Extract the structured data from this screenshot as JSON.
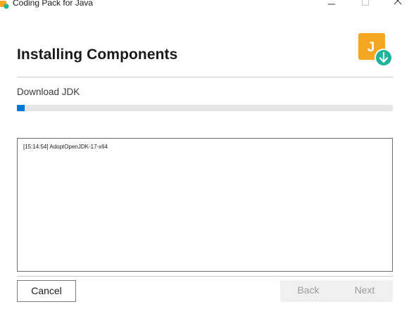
{
  "window": {
    "title": "Coding Pack for Java",
    "controls": {
      "minimize": "minimize-icon",
      "maximize": "maximize-icon",
      "close": "close-icon"
    }
  },
  "header": {
    "title": "Installing Components",
    "logo": {
      "letter": "J",
      "icon": "download-arrow-icon",
      "colors": {
        "tile": "#f5a623",
        "badge": "#1fb39a"
      }
    }
  },
  "progress": {
    "step_label": "Download JDK",
    "percent": 2,
    "color": "#0078d7"
  },
  "log": {
    "lines": [
      "[15:14:54] AdoptOpenJDK-17-x64"
    ]
  },
  "footer": {
    "cancel_label": "Cancel",
    "back_label": "Back",
    "next_label": "Next"
  }
}
